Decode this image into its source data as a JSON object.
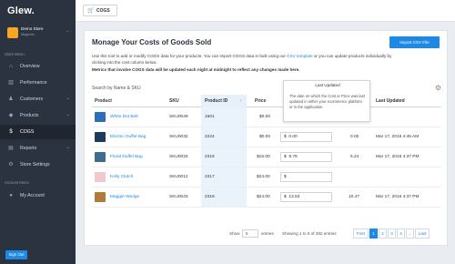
{
  "app": {
    "logo": "Glew."
  },
  "store": {
    "name": "Demo Store",
    "platform": "Magento",
    "caret": "⌄"
  },
  "sidebar": {
    "store_menu_label": "Store Menu",
    "items": [
      {
        "label": "Overview",
        "icon": "⌂"
      },
      {
        "label": "Performance",
        "icon": "▥"
      },
      {
        "label": "Customers",
        "icon": "♟",
        "caret": "⌄"
      },
      {
        "label": "Products",
        "icon": "◆",
        "caret": "⌄"
      },
      {
        "label": "COGS",
        "icon": "$"
      },
      {
        "label": "Reports",
        "icon": "▤",
        "caret": "⌄"
      },
      {
        "label": "Store Settings",
        "icon": "⚙"
      }
    ],
    "account_menu_label": "Account Menu",
    "account_items": [
      {
        "label": "My Account",
        "icon": "●"
      }
    ],
    "signout_label": "Sign Out"
  },
  "topbar": {
    "crumb_label": "COGS"
  },
  "main": {
    "title": "Monage Your Costs of Goods Sold",
    "import_button": "Import CSV File",
    "description_part1": "Use this tool to add or modify COGS data for your products. You can import COGS data in bulk using our",
    "description_link": "CSV template",
    "description_part2": "or you can update products individually by clicking into the cost column below.",
    "description_bold": "Metrics that involve COGS data will be updated each night at midnight to reflect any changes made here.",
    "search_placeholder": "Search by Name & SKU"
  },
  "table": {
    "headers": [
      "Product",
      "SKU",
      "Product ID",
      "Price",
      "Last Updated"
    ],
    "sort_indicator": "↑",
    "rows": [
      {
        "name": "White Dot Belt",
        "sku": "SKU0049",
        "id": "1601",
        "price": "$0.00",
        "cost": "",
        "profit": "",
        "updated": "",
        "thumb_color": "#2e6fb5"
      },
      {
        "name": "Electric Duffel Bag",
        "sku": "SKU0032",
        "id": "2224",
        "price": "$0.00",
        "cost": "0.00",
        "profit": "0.00",
        "updated": "Mar 17, 2016 4:45 AM",
        "thumb_color": "#1b3c5c"
      },
      {
        "name": "Floral Duffel Bag",
        "sku": "SKU0034",
        "id": "2316",
        "price": "$15.00",
        "cost": "9.76",
        "profit": "5.24",
        "updated": "Mar 17, 2016 4:37 PM",
        "thumb_color": "#3f6b8f"
      },
      {
        "name": "Kelly Clutch",
        "sku": "SKU0012",
        "id": "2317",
        "price": "$24.00",
        "cost": "",
        "profit": "",
        "updated": "",
        "thumb_color": "#f2c7cf"
      },
      {
        "name": "Maggie Wedge",
        "sku": "SKU0043",
        "id": "2318",
        "price": "$24.00",
        "cost": "13.53",
        "profit": "10.47",
        "updated": "Mar 17, 2016 4:37 PM",
        "thumb_color": "#b07a3b"
      }
    ]
  },
  "tooltip": {
    "title": "Last Updated",
    "body": "The date on which the Cost or Price was last updated in either your ecommerce platform or in the application."
  },
  "footer": {
    "show_label": "Show",
    "show_value": "5",
    "entries_label": "entries",
    "showing_text": "Showing 1 to 5 of 392 entries",
    "pager": [
      "First",
      "1",
      "2",
      "3",
      "4",
      "...",
      "Last"
    ]
  },
  "colors": {
    "accent": "#1e88e5",
    "sidebar": "#2b3341"
  }
}
